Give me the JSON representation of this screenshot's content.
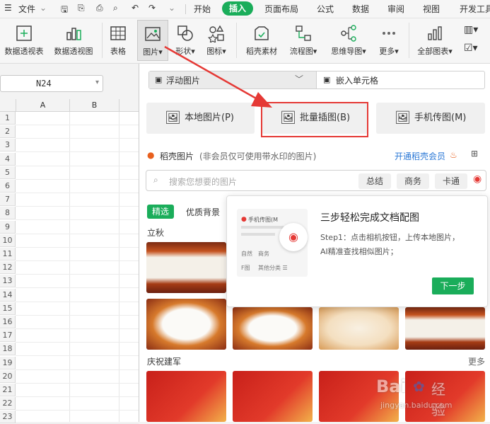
{
  "menubar": {
    "file": "文件",
    "tabs": [
      "开始",
      "插入",
      "页面布局",
      "公式",
      "数据",
      "审阅",
      "视图",
      "开发工具"
    ],
    "active_tab": "插入"
  },
  "ribbon": {
    "buttons": [
      "数据透视表",
      "数据透视图",
      "表格",
      "图片",
      "形状",
      "图标",
      "稻壳素材",
      "流程图",
      "思维导图",
      "更多",
      "全部图表"
    ]
  },
  "namebox": {
    "value": "N24"
  },
  "sheet": {
    "columns": [
      "A",
      "B"
    ],
    "rows": [
      "1",
      "2",
      "3",
      "4",
      "5",
      "6",
      "7",
      "8",
      "9",
      "10",
      "11",
      "12",
      "13",
      "14",
      "15",
      "16",
      "17",
      "18",
      "19",
      "20",
      "21",
      "22",
      "23"
    ]
  },
  "panel": {
    "float_image": "浮动图片",
    "embed_cell": "嵌入单元格",
    "local_image": "本地图片(P)",
    "batch_insert": "批量插图(B)",
    "phone_image": "手机传图(M)",
    "docer_title": "稻壳图片",
    "docer_note": "(非会员仅可使用带水印的图片)",
    "open_member": "开通稻壳会员",
    "search_placeholder": "搜索您想要的图片",
    "chips": [
      "总结",
      "商务",
      "卡通"
    ],
    "filter_selected": "精选",
    "filter_other": "优质背景",
    "section1": "立秋",
    "section2": "庆祝建军",
    "more": "更多"
  },
  "popup": {
    "title": "三步轻松完成文档配图",
    "desc_line1": "Step1：点击相机按钮，上传本地图片，",
    "desc_line2": "AI精准查找相似图片；",
    "next": "下一步",
    "preview_label1": "手机传图(M",
    "preview_label2": "自然",
    "preview_label3": "商务",
    "preview_label4": "F图",
    "preview_label5": "其他分类 ☰"
  },
  "watermark": {
    "text1": "Bai",
    "text2": "经验",
    "text3": "jingyan.baidu.com"
  },
  "colors": {
    "accent": "#1aad5a",
    "highlight": "#e53935"
  }
}
